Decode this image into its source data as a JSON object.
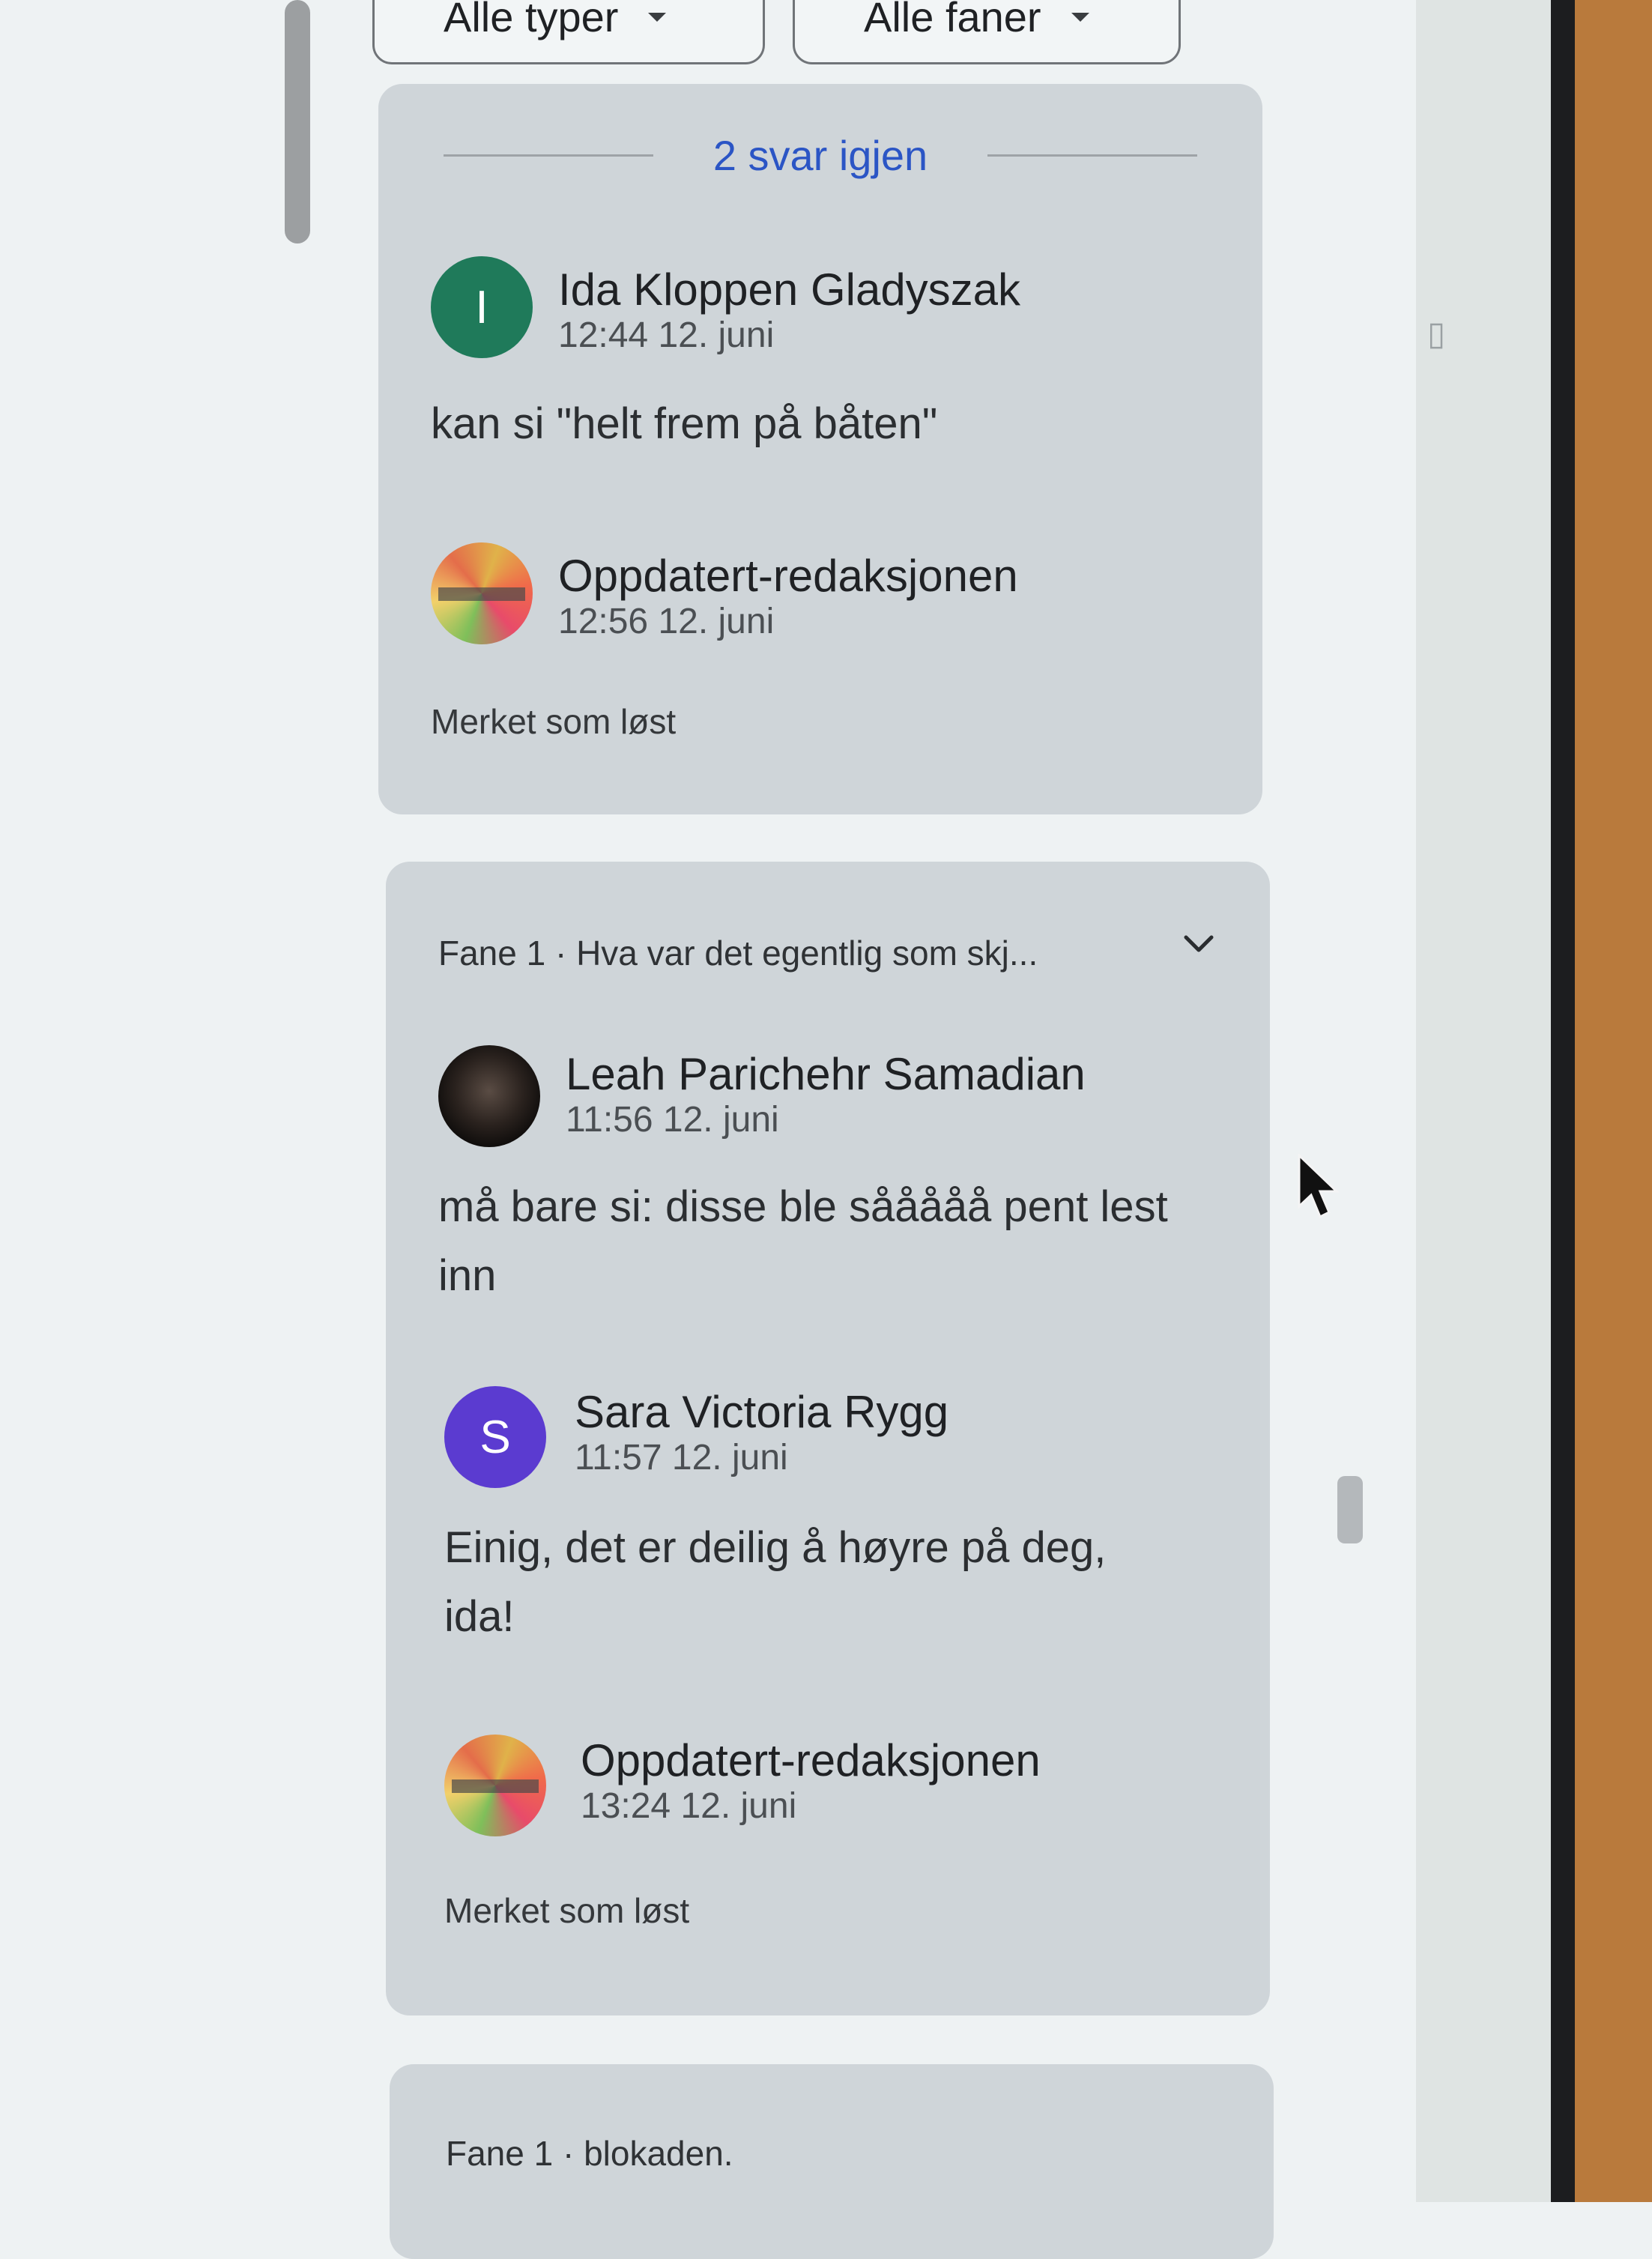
{
  "filters": {
    "types_label": "Alle typer",
    "tabs_label": "Alle faner"
  },
  "thread1": {
    "replies_label": "2 svar igjen",
    "comments": [
      {
        "initial": "I",
        "author": "Ida Kloppen Gladyszak",
        "time": "12:44 12. juni",
        "text": "kan si \"helt frem på båten\""
      },
      {
        "author": "Oppdatert-redaksjonen",
        "time": "12:56 12. juni",
        "status": "Merket som løst"
      }
    ]
  },
  "thread2": {
    "header": "Fane 1 · Hva var det egentlig som skj...",
    "comments": [
      {
        "author": "Leah Parichehr Samadian",
        "time": "11:56 12. juni",
        "text_line1": "må bare si: disse ble sååååå pent lest",
        "text_line2": "inn"
      },
      {
        "initial": "S",
        "author": "Sara Victoria Rygg",
        "time": "11:57 12. juni",
        "text_line1": "Einig, det er deilig å høyre på deg,",
        "text_line2": "ida!"
      },
      {
        "author": "Oppdatert-redaksjonen",
        "time": "13:24 12. juni",
        "status": "Merket som løst"
      }
    ]
  },
  "thread3": {
    "header": "Fane 1 · blokaden."
  },
  "icons": {
    "dropdown": "caret-down-icon",
    "expand": "chevron-down-icon",
    "pointer": "mouse-cursor-icon"
  },
  "colors": {
    "avatar_ida": "#1f7a5a",
    "avatar_sara": "#5b3bd0",
    "link_blue": "#2b55c5"
  }
}
